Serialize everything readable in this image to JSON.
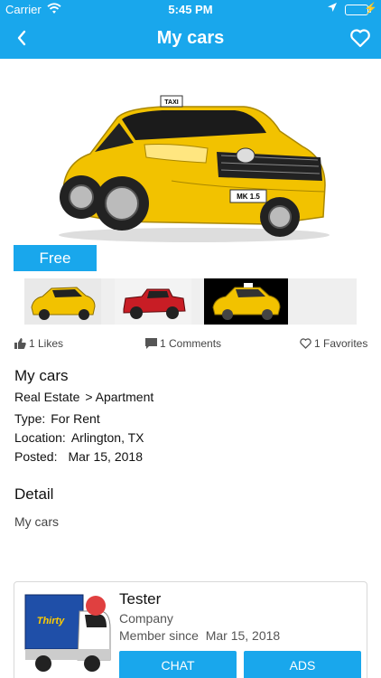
{
  "status_bar": {
    "carrier": "Carrier",
    "time": "5:45 PM"
  },
  "nav": {
    "title": "My cars",
    "back_icon": "chevron-left-icon",
    "fav_icon": "heart-outline-icon"
  },
  "listing": {
    "badge": "Free",
    "stats": {
      "likes": "1 Likes",
      "comments": "1 Comments",
      "favorites": "1 Favorites"
    },
    "title": "My cars",
    "category": "Real Estate",
    "subcategory": "> Apartment",
    "type_label": "Type:",
    "type_value": "For Rent",
    "location_label": "Location:",
    "location_value": "Arlington, TX",
    "posted_label": "Posted:",
    "posted_value": "Mar 15, 2018"
  },
  "detail": {
    "heading": "Detail",
    "text": "My cars"
  },
  "hero_plate": "MK 1.5",
  "hero_sign": "TAXI",
  "seller": {
    "name": "Tester",
    "type": "Company",
    "since_label": "Member since",
    "since_value": "Mar 15, 2018",
    "chat_label": "CHAT",
    "ads_label": "ADS",
    "truck_logo_text": "Thirty"
  },
  "colors": {
    "accent": "#19a7ec",
    "taxi_yellow": "#f2c200",
    "battery": "#7CFC66"
  }
}
